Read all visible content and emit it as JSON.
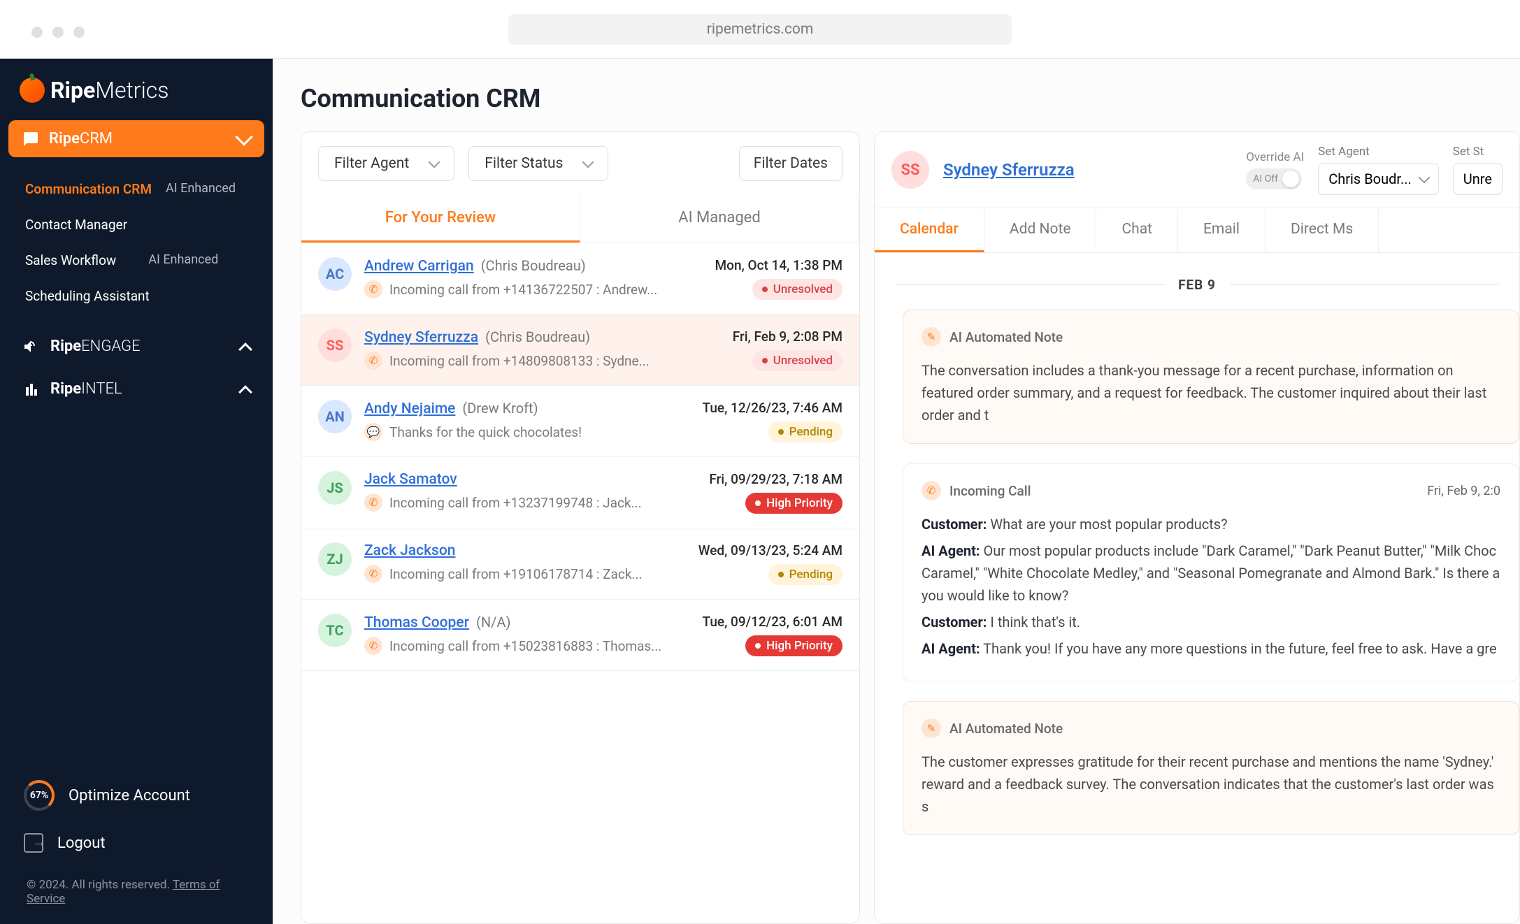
{
  "browser": {
    "url": "ripemetrics.com"
  },
  "brand": {
    "logo_bold": "Ripe",
    "logo_thin": "Metrics"
  },
  "sidebar": {
    "primary": {
      "bold": "Ripe",
      "thin": "CRM"
    },
    "items": {
      "comm": "Communication CRM",
      "ai": "AI Enhanced",
      "contact": "Contact Manager",
      "sales": "Sales Workflow",
      "sched": "Scheduling Assistant"
    },
    "sections": {
      "engage_bold": "Ripe",
      "engage_thin": "ENGAGE",
      "intel_bold": "Ripe",
      "intel_thin": "INTEL"
    },
    "optimize_pct": "67%",
    "optimize": "Optimize Account",
    "logout": "Logout",
    "copyright": "© 2024. All rights reserved.",
    "tos": "Terms of Service"
  },
  "page": {
    "title": "Communication CRM",
    "filters": {
      "agent": "Filter Agent",
      "status": "Filter Status",
      "dates": "Filter Dates"
    },
    "tabs": {
      "review": "For Your Review",
      "ai": "AI Managed"
    },
    "rows": [
      {
        "initials": "AC",
        "color": "#d9e8ff",
        "tcolor": "#4a77c4",
        "name": "Andrew Carrigan",
        "agent": "(Chris Boudreau)",
        "sub": "Incoming call from +14136722507 : Andrew...",
        "time": "Mon, Oct 14, 1:38 PM",
        "status": "Unresolved",
        "statusClass": "unresolved",
        "icon": "call"
      },
      {
        "initials": "SS",
        "color": "#ffdede",
        "tcolor": "#ff5a5a",
        "name": "Sydney Sferruzza",
        "agent": "(Chris Boudreau)",
        "sub": "Incoming call from +14809808133 : Sydne...",
        "time": "Fri, Feb 9, 2:08 PM",
        "status": "Unresolved",
        "statusClass": "unresolved",
        "icon": "call",
        "selected": true
      },
      {
        "initials": "AN",
        "color": "#d9e8ff",
        "tcolor": "#4a77c4",
        "name": "Andy Nejaime",
        "agent": "(Drew Kroft)",
        "sub": "Thanks for the quick chocolates!",
        "time": "Tue, 12/26/23, 7:46 AM",
        "status": "Pending",
        "statusClass": "pending",
        "icon": "msg"
      },
      {
        "initials": "JS",
        "color": "#d6f3dd",
        "tcolor": "#3ca060",
        "name": "Jack Samatov",
        "agent": "",
        "sub": "Incoming call from +13237199748 : Jack...",
        "time": "Fri, 09/29/23, 7:18 AM",
        "status": "High Priority",
        "statusClass": "highpri",
        "icon": "call"
      },
      {
        "initials": "ZJ",
        "color": "#d6f3dd",
        "tcolor": "#3ca060",
        "name": "Zack Jackson",
        "agent": "",
        "sub": "Incoming call from +19106178714 : Zack...",
        "time": "Wed, 09/13/23, 5:24 AM",
        "status": "Pending",
        "statusClass": "pending",
        "icon": "call"
      },
      {
        "initials": "TC",
        "color": "#d6f3dd",
        "tcolor": "#3ca060",
        "name": "Thomas Cooper",
        "agent": "(N/A)",
        "sub": "Incoming call from +15023816883 : Thomas...",
        "time": "Tue, 09/12/23, 6:01 AM",
        "status": "High Priority",
        "statusClass": "highpri",
        "icon": "call"
      }
    ]
  },
  "detail": {
    "initials": "SS",
    "name": "Sydney Sferruzza",
    "override_label": "Override AI",
    "toggle_text": "AI Off",
    "set_agent_label": "Set Agent",
    "set_agent_value": "Chris Boudr...",
    "set_status_label": "Set St",
    "set_status_value": "Unre",
    "tabs": {
      "calendar": "Calendar",
      "note": "Add Note",
      "chat": "Chat",
      "email": "Email",
      "dm": "Direct Ms"
    },
    "date": "FEB 9",
    "note1": {
      "title": "AI Automated Note",
      "body": "The conversation includes a thank-you message for a recent purchase, information on featured order summary, and a request for feedback. The customer inquired about their last order and t"
    },
    "call": {
      "title": "Incoming Call",
      "time": "Fri, Feb 9, 2:0",
      "l1a": "Customer:",
      "l1b": "What are your most popular products?",
      "l2a": "AI Agent:",
      "l2b": "Our most popular products include \"Dark Caramel,\" \"Dark Peanut Butter,\" \"Milk Choc Caramel,\" \"White Chocolate Medley,\" and \"Seasonal Pomegranate and Almond Bark.\" Is there a you would like to know?",
      "l3a": "Customer:",
      "l3b": "I think that's it.",
      "l4a": "AI Agent:",
      "l4b": "Thank you! If you have any more questions in the future, feel free to ask. Have a gre"
    },
    "note2": {
      "title": "AI Automated Note",
      "body": "The customer expresses gratitude for their recent purchase and mentions the name 'Sydney.' reward and a feedback survey. The conversation indicates that the customer's last order was s"
    }
  }
}
